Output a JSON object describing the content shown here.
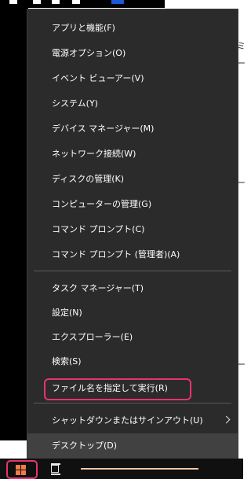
{
  "menu": {
    "items": [
      {
        "label": "アプリと機能(F)",
        "name": "menu-item-apps-features"
      },
      {
        "label": "電源オプション(O)",
        "name": "menu-item-power-options"
      },
      {
        "label": "イベント ビューアー(V)",
        "name": "menu-item-event-viewer"
      },
      {
        "label": "システム(Y)",
        "name": "menu-item-system"
      },
      {
        "label": "デバイス マネージャー(M)",
        "name": "menu-item-device-manager"
      },
      {
        "label": "ネットワーク接続(W)",
        "name": "menu-item-network-connections"
      },
      {
        "label": "ディスクの管理(K)",
        "name": "menu-item-disk-management"
      },
      {
        "label": "コンピューターの管理(G)",
        "name": "menu-item-computer-management"
      },
      {
        "label": "コマンド プロンプト(C)",
        "name": "menu-item-command-prompt"
      },
      {
        "label": "コマンド プロンプト (管理者)(A)",
        "name": "menu-item-command-prompt-admin"
      },
      {
        "label": "タスク マネージャー(T)",
        "name": "menu-item-task-manager"
      },
      {
        "label": "設定(N)",
        "name": "menu-item-settings"
      },
      {
        "label": "エクスプローラー(E)",
        "name": "menu-item-explorer"
      },
      {
        "label": "検索(S)",
        "name": "menu-item-search"
      },
      {
        "label": "ファイル名を指定して実行(R)",
        "name": "menu-item-run"
      },
      {
        "label": "シャットダウンまたはサインアウト(U)",
        "name": "menu-item-shutdown-signout",
        "submenu": true
      },
      {
        "label": "デスクトップ(D)",
        "name": "menu-item-desktop",
        "selected": true
      }
    ],
    "highlighted_item": "ファイル名を指定して実行(R)"
  },
  "taskbar": {
    "start_icon": "windows-logo-icon",
    "task_view_icon": "task-view-icon"
  },
  "colors": {
    "menu_background": "#2b2b2b",
    "menu_text": "#ffffff",
    "selected_background": "#414141",
    "annotation_highlight": "#e8336d",
    "start_logo": "#f07c4a"
  }
}
